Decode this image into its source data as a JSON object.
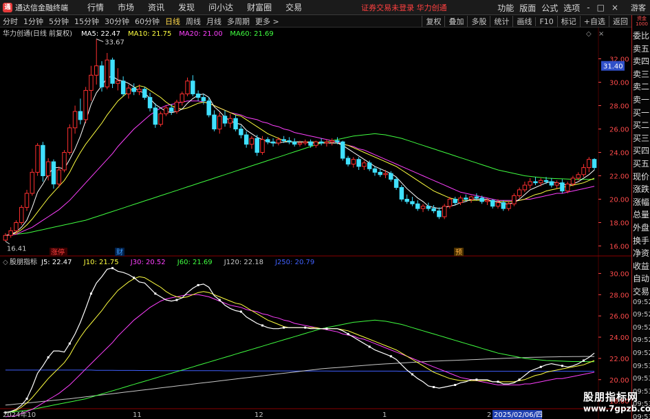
{
  "app": {
    "title": "通达信金融终端",
    "menu": [
      "行情",
      "市场",
      "资讯",
      "发现",
      "问小达",
      "财富圈",
      "交易"
    ],
    "notice": "证券交易未登录  华力创通",
    "right_menu": [
      "功能",
      "版面",
      "公式",
      "选项"
    ],
    "window_controls": [
      "-",
      "□",
      "×"
    ],
    "guest": "游客"
  },
  "toolbar": {
    "periods": [
      "分时",
      "1分钟",
      "5分钟",
      "15分钟",
      "30分钟",
      "60分钟",
      "日线",
      "周线",
      "月线",
      "多周期",
      "更多 >"
    ],
    "active_period": "日线",
    "right_tools": [
      "复权",
      "叠加",
      "多股",
      "统计",
      "画线",
      "F10",
      "标记",
      "+自选",
      "返回"
    ]
  },
  "right_column": {
    "logo": "资金 1000",
    "rows": [
      "委比",
      "卖五",
      "卖四",
      "卖三",
      "卖二",
      "卖一",
      "买一",
      "买二",
      "买三",
      "买四",
      "买五",
      "现价",
      "涨跌",
      "涨幅",
      "总量",
      "外盘",
      "换手",
      "净资",
      "收益",
      "自动",
      "交易",
      "09:52",
      "09:52",
      "09:52",
      "09:52",
      "09:52",
      "09:53",
      "09:53",
      "09:53",
      "09:53",
      "09:53"
    ]
  },
  "main_panel": {
    "stock_label": "华力创通(日线 前复权)",
    "legend": [
      {
        "label": "MA5: 22.47",
        "color": "#ffffff"
      },
      {
        "label": "MA10: 21.75",
        "color": "#ffff40"
      },
      {
        "label": "MA20: 21.00",
        "color": "#ff40ff"
      },
      {
        "label": "MA60: 21.69",
        "color": "#40ff40"
      }
    ],
    "high_annotation": "33.67",
    "low_annotation": "16.41",
    "current_price_tag": "31.40",
    "event_tags": [
      "涨停",
      "财",
      "预"
    ],
    "y_ticks": [
      "32.00",
      "30.00",
      "28.00",
      "26.00",
      "24.00",
      "22.00",
      "20.00",
      "18.00",
      "16.00"
    ]
  },
  "sub_panel": {
    "indicator_name": "股朋指标",
    "legend": [
      {
        "label": "J5: 22.47",
        "color": "#ffffff"
      },
      {
        "label": "J10: 21.75",
        "color": "#ffff40"
      },
      {
        "label": "J30: 20.52",
        "color": "#ff40ff"
      },
      {
        "label": "J60: 21.69",
        "color": "#40ff40"
      },
      {
        "label": "J120: 22.18",
        "color": "#c8c8c8"
      },
      {
        "label": "J250: 20.79",
        "color": "#4060ff"
      }
    ],
    "y_ticks": [
      "30.00",
      "28.00",
      "26.00",
      "24.00",
      "22.00",
      "20.00",
      "18.00"
    ]
  },
  "x_axis_labels": [
    "2024年10",
    "11",
    "12",
    "1",
    "2",
    "2025/02/06/四"
  ],
  "watermark": {
    "name": "股朋指标网",
    "url": "www.7gpzb.com"
  },
  "colors": {
    "up": "#ff3030",
    "down": "#40e0ff",
    "ma5": "#ffffff",
    "ma10": "#ffff40",
    "ma20": "#ff40ff",
    "ma60": "#40ff40",
    "j120": "#c8c8c8",
    "j250": "#4060ff",
    "grid": "#4a0000"
  },
  "chart_data": {
    "type": "candlestick",
    "ylim": [
      15.5,
      33.5
    ],
    "sub_ylim": [
      17.2,
      31.0
    ],
    "candles": [
      [
        16.5,
        17.1,
        16.4,
        16.9
      ],
      [
        16.9,
        17.6,
        16.7,
        17.3
      ],
      [
        17.3,
        18.2,
        17.0,
        18.0
      ],
      [
        18.0,
        19.5,
        17.8,
        19.3
      ],
      [
        19.3,
        20.8,
        19.0,
        20.5
      ],
      [
        20.5,
        22.6,
        20.3,
        22.3
      ],
      [
        22.3,
        24.8,
        22.0,
        24.6
      ],
      [
        24.6,
        24.9,
        21.5,
        22.0
      ],
      [
        22.0,
        23.5,
        21.6,
        23.2
      ],
      [
        23.2,
        23.4,
        20.9,
        21.3
      ],
      [
        21.3,
        22.8,
        21.0,
        22.5
      ],
      [
        22.5,
        24.2,
        22.3,
        24.0
      ],
      [
        24.0,
        26.4,
        23.8,
        26.1
      ],
      [
        26.1,
        28.0,
        25.6,
        27.5
      ],
      [
        27.5,
        28.6,
        26.4,
        26.8
      ],
      [
        26.8,
        29.6,
        26.5,
        29.3
      ],
      [
        29.3,
        31.4,
        28.4,
        30.6
      ],
      [
        30.6,
        33.7,
        29.8,
        31.4
      ],
      [
        31.4,
        31.8,
        29.2,
        29.6
      ],
      [
        29.6,
        32.5,
        29.4,
        31.9
      ],
      [
        31.9,
        32.1,
        29.5,
        29.9
      ],
      [
        29.9,
        31.2,
        29.3,
        30.1
      ],
      [
        30.1,
        30.5,
        28.8,
        29.0
      ],
      [
        29.0,
        29.8,
        28.6,
        29.5
      ],
      [
        29.5,
        29.9,
        28.9,
        29.2
      ],
      [
        29.2,
        29.8,
        28.9,
        29.4
      ],
      [
        29.4,
        29.6,
        28.5,
        28.7
      ],
      [
        28.7,
        29.1,
        27.5,
        27.8
      ],
      [
        27.8,
        28.2,
        26.1,
        26.4
      ],
      [
        26.4,
        27.5,
        26.2,
        27.3
      ],
      [
        27.3,
        28.0,
        27.1,
        27.8
      ],
      [
        27.8,
        28.1,
        27.2,
        27.5
      ],
      [
        27.5,
        28.5,
        27.3,
        28.3
      ],
      [
        28.3,
        29.2,
        28.0,
        29.0
      ],
      [
        29.0,
        30.4,
        28.8,
        30.1
      ],
      [
        30.1,
        30.6,
        28.8,
        29.0
      ],
      [
        29.0,
        29.3,
        28.4,
        28.7
      ],
      [
        28.7,
        29.0,
        28.1,
        28.4
      ],
      [
        28.4,
        28.7,
        27.0,
        27.2
      ],
      [
        27.2,
        27.6,
        25.8,
        26.0
      ],
      [
        26.0,
        27.4,
        25.6,
        27.1
      ],
      [
        27.1,
        27.6,
        26.2,
        26.5
      ],
      [
        26.5,
        27.3,
        26.1,
        26.9
      ],
      [
        26.9,
        27.2,
        25.8,
        26.0
      ],
      [
        26.0,
        26.3,
        25.2,
        25.5
      ],
      [
        25.5,
        25.8,
        24.4,
        24.7
      ],
      [
        24.7,
        25.4,
        24.3,
        25.2
      ],
      [
        25.2,
        25.5,
        23.7,
        24.0
      ],
      [
        24.0,
        25.4,
        23.8,
        25.1
      ],
      [
        25.1,
        25.3,
        24.7,
        24.9
      ],
      [
        24.9,
        25.2,
        24.5,
        24.8
      ],
      [
        24.8,
        25.3,
        24.6,
        25.1
      ],
      [
        25.1,
        25.4,
        24.8,
        25.0
      ],
      [
        25.0,
        25.3,
        24.7,
        24.9
      ],
      [
        24.9,
        25.2,
        24.5,
        24.7
      ],
      [
        24.7,
        25.0,
        24.5,
        24.8
      ],
      [
        24.8,
        25.1,
        24.6,
        24.9
      ],
      [
        24.9,
        25.1,
        24.4,
        24.6
      ],
      [
        24.6,
        25.0,
        24.4,
        24.9
      ],
      [
        24.9,
        25.2,
        24.6,
        24.8
      ],
      [
        24.8,
        25.1,
        24.5,
        24.9
      ],
      [
        24.9,
        25.2,
        24.6,
        25.0
      ],
      [
        25.0,
        25.3,
        24.7,
        24.9
      ],
      [
        24.9,
        25.0,
        23.3,
        23.5
      ],
      [
        23.5,
        23.7,
        22.8,
        23.0
      ],
      [
        23.0,
        23.6,
        22.7,
        23.4
      ],
      [
        23.4,
        23.6,
        22.5,
        22.8
      ],
      [
        22.8,
        23.3,
        22.5,
        23.1
      ],
      [
        23.1,
        23.3,
        22.4,
        22.6
      ],
      [
        22.6,
        22.8,
        22.0,
        22.3
      ],
      [
        22.3,
        22.6,
        21.9,
        22.1
      ],
      [
        22.1,
        22.5,
        21.8,
        22.2
      ],
      [
        22.2,
        22.4,
        21.5,
        21.7
      ],
      [
        21.7,
        21.9,
        20.8,
        21.0
      ],
      [
        21.0,
        21.2,
        19.8,
        20.0
      ],
      [
        20.0,
        20.4,
        19.6,
        19.8
      ],
      [
        19.8,
        20.2,
        19.4,
        19.6
      ],
      [
        19.6,
        19.9,
        19.0,
        19.2
      ],
      [
        19.2,
        19.6,
        18.9,
        19.4
      ],
      [
        19.4,
        19.7,
        19.0,
        19.2
      ],
      [
        19.2,
        19.5,
        18.8,
        19.0
      ],
      [
        19.0,
        19.3,
        18.3,
        18.5
      ],
      [
        18.5,
        19.6,
        18.3,
        19.4
      ],
      [
        19.4,
        20.2,
        19.2,
        20.0
      ],
      [
        20.0,
        20.2,
        19.5,
        19.7
      ],
      [
        19.7,
        20.3,
        19.5,
        20.1
      ],
      [
        20.1,
        20.4,
        19.8,
        20.0
      ],
      [
        20.0,
        20.3,
        19.7,
        20.2
      ],
      [
        20.2,
        20.5,
        19.9,
        20.1
      ],
      [
        20.1,
        20.3,
        19.6,
        19.8
      ],
      [
        19.8,
        20.1,
        19.5,
        19.9
      ],
      [
        19.9,
        20.0,
        19.2,
        19.4
      ],
      [
        19.4,
        20.0,
        19.2,
        19.7
      ],
      [
        19.7,
        19.9,
        19.0,
        19.2
      ],
      [
        19.2,
        19.8,
        19.0,
        19.6
      ],
      [
        19.6,
        20.5,
        19.4,
        20.3
      ],
      [
        20.3,
        21.0,
        20.1,
        20.8
      ],
      [
        20.8,
        21.5,
        20.6,
        21.2
      ],
      [
        21.2,
        21.8,
        20.9,
        21.5
      ],
      [
        21.5,
        21.9,
        21.2,
        21.4
      ],
      [
        21.4,
        21.8,
        21.1,
        21.6
      ],
      [
        21.6,
        21.9,
        21.3,
        21.5
      ],
      [
        21.5,
        21.8,
        21.0,
        21.2
      ],
      [
        21.2,
        21.6,
        20.9,
        21.4
      ],
      [
        21.4,
        21.7,
        20.5,
        20.7
      ],
      [
        20.7,
        21.5,
        20.5,
        21.3
      ],
      [
        21.3,
        22.0,
        21.1,
        21.8
      ],
      [
        21.8,
        22.3,
        21.6,
        22.1
      ],
      [
        22.1,
        23.0,
        21.9,
        22.7
      ],
      [
        22.7,
        23.6,
        22.3,
        23.4
      ],
      [
        23.4,
        23.5,
        22.5,
        22.7
      ]
    ],
    "ma5": [
      16.9,
      17.0,
      17.2,
      17.6,
      18.2,
      19.3,
      20.6,
      21.3,
      22.1,
      22.7,
      22.7,
      22.6,
      23.4,
      24.3,
      25.4,
      26.7,
      28.1,
      29.1,
      29.7,
      30.4,
      30.5,
      30.2,
      30.1,
      29.9,
      29.6,
      29.2,
      29.1,
      28.6,
      28.1,
      27.8,
      27.5,
      27.4,
      27.5,
      27.7,
      28.2,
      28.6,
      28.9,
      29.0,
      28.7,
      27.9,
      27.5,
      27.0,
      26.7,
      26.5,
      26.4,
      25.9,
      25.6,
      25.3,
      25.1,
      24.9,
      24.8,
      24.8,
      24.9,
      24.9,
      24.9,
      24.9,
      24.9,
      24.8,
      24.8,
      24.8,
      24.8,
      24.8,
      24.8,
      24.6,
      24.3,
      24.0,
      23.7,
      23.4,
      23.1,
      22.8,
      22.6,
      22.4,
      22.2,
      21.9,
      21.4,
      20.9,
      20.5,
      20.1,
      19.8,
      19.4,
      19.3,
      19.2,
      19.3,
      19.4,
      19.5,
      19.7,
      19.8,
      20.0,
      20.0,
      20.0,
      20.0,
      19.8,
      19.8,
      19.6,
      19.6,
      19.7,
      20.0,
      20.4,
      20.8,
      21.0,
      21.2,
      21.4,
      21.5,
      21.4,
      21.3,
      21.2,
      21.3,
      21.5,
      21.8,
      22.1,
      22.5
    ],
    "ma10": [
      16.9,
      17.0,
      17.1,
      17.4,
      17.8,
      18.3,
      18.9,
      19.5,
      20.1,
      20.6,
      21.1,
      21.6,
      22.3,
      23.2,
      24.0,
      24.7,
      25.3,
      25.9,
      26.5,
      27.2,
      27.8,
      28.4,
      28.8,
      29.2,
      29.5,
      29.7,
      29.6,
      29.3,
      29.0,
      28.7,
      28.3,
      28.0,
      27.8,
      27.7,
      27.8,
      28.0,
      28.2,
      28.3,
      28.2,
      28.0,
      27.8,
      27.6,
      27.4,
      27.2,
      27.1,
      26.8,
      26.5,
      26.2,
      25.9,
      25.6,
      25.4,
      25.2,
      25.0,
      24.9,
      24.9,
      24.9,
      24.9,
      24.9,
      24.9,
      24.8,
      24.8,
      24.8,
      24.8,
      24.7,
      24.6,
      24.4,
      24.2,
      24.0,
      23.8,
      23.6,
      23.4,
      23.2,
      23.0,
      22.8,
      22.5,
      22.2,
      21.9,
      21.6,
      21.3,
      21.0,
      20.7,
      20.5,
      20.3,
      20.1,
      20.0,
      19.9,
      19.9,
      19.9,
      19.9,
      19.9,
      19.9,
      19.8,
      19.8,
      19.8,
      19.8,
      19.8,
      19.9,
      20.0,
      20.2,
      20.4,
      20.5,
      20.7,
      20.8,
      20.9,
      21.0,
      21.1,
      21.2,
      21.3,
      21.4,
      21.6,
      21.8
    ],
    "ma20": [
      16.9,
      16.95,
      17.0,
      17.2,
      17.4,
      17.6,
      17.9,
      18.2,
      18.5,
      18.8,
      19.1,
      19.5,
      19.9,
      20.4,
      20.9,
      21.4,
      21.9,
      22.4,
      22.9,
      23.4,
      23.9,
      24.5,
      25.0,
      25.5,
      26.0,
      26.4,
      26.8,
      27.2,
      27.5,
      27.8,
      28.0,
      28.1,
      28.2,
      28.3,
      28.4,
      28.4,
      28.4,
      28.3,
      28.2,
      28.0,
      27.8,
      27.6,
      27.4,
      27.3,
      27.2,
      27.0,
      26.9,
      26.8,
      26.6,
      26.5,
      26.3,
      26.2,
      26.0,
      25.9,
      25.7,
      25.6,
      25.5,
      25.4,
      25.3,
      25.2,
      25.1,
      25.0,
      24.9,
      24.7,
      24.6,
      24.5,
      24.3,
      24.2,
      24.0,
      23.8,
      23.6,
      23.4,
      23.2,
      23.0,
      22.8,
      22.6,
      22.4,
      22.2,
      22.0,
      21.8,
      21.6,
      21.4,
      21.2,
      21.0,
      20.8,
      20.6,
      20.5,
      20.4,
      20.3,
      20.2,
      20.1,
      20.0,
      19.9,
      19.9,
      19.9,
      19.9,
      19.9,
      20.0,
      20.0,
      20.1,
      20.2,
      20.3,
      20.4,
      20.5,
      20.5,
      20.6,
      20.7,
      20.8,
      20.9,
      21.0,
      21.1
    ],
    "ma60": [
      16.9,
      16.95,
      17.0,
      17.05,
      17.1,
      17.2,
      17.3,
      17.4,
      17.5,
      17.6,
      17.7,
      17.8,
      17.9,
      18.0,
      18.1,
      18.2,
      18.35,
      18.5,
      18.65,
      18.8,
      18.95,
      19.1,
      19.25,
      19.4,
      19.55,
      19.7,
      19.85,
      20.0,
      20.15,
      20.3,
      20.45,
      20.6,
      20.75,
      20.9,
      21.05,
      21.2,
      21.35,
      21.5,
      21.65,
      21.8,
      21.95,
      22.1,
      22.25,
      22.4,
      22.55,
      22.7,
      22.85,
      23.0,
      23.15,
      23.3,
      23.45,
      23.6,
      23.75,
      23.9,
      24.05,
      24.2,
      24.35,
      24.5,
      24.65,
      24.8,
      24.9,
      25.0,
      25.1,
      25.2,
      25.3,
      25.4,
      25.45,
      25.5,
      25.55,
      25.6,
      25.55,
      25.5,
      25.4,
      25.3,
      25.2,
      25.05,
      24.9,
      24.75,
      24.6,
      24.45,
      24.3,
      24.15,
      24.0,
      23.85,
      23.7,
      23.55,
      23.4,
      23.25,
      23.1,
      22.95,
      22.8,
      22.65,
      22.5,
      22.4,
      22.3,
      22.2,
      22.1,
      22.0,
      21.95,
      21.9,
      21.85,
      21.8,
      21.78,
      21.76,
      21.74,
      21.72,
      21.7,
      21.7,
      21.7,
      21.69,
      21.69
    ],
    "j250": [
      20.9,
      20.9,
      20.9,
      20.9,
      20.9,
      20.9,
      20.9,
      20.9,
      20.9,
      20.9,
      20.9,
      20.9,
      20.9,
      20.9,
      20.9,
      20.9,
      20.9,
      20.88,
      20.88,
      20.88,
      20.88,
      20.87,
      20.87,
      20.87,
      20.87,
      20.86,
      20.86,
      20.86,
      20.86,
      20.85,
      20.85,
      20.85,
      20.85,
      20.85,
      20.85,
      20.84,
      20.84,
      20.84,
      20.84,
      20.84,
      20.84,
      20.83,
      20.83,
      20.83,
      20.83,
      20.83,
      20.83,
      20.82,
      20.82,
      20.82,
      20.82,
      20.82,
      20.82,
      20.82,
      20.81,
      20.81,
      20.81,
      20.81,
      20.81,
      20.81,
      20.81,
      20.8,
      20.8,
      20.8,
      20.8,
      20.8,
      20.8,
      20.8,
      20.8,
      20.8,
      20.8,
      20.8,
      20.8,
      20.8,
      20.79,
      20.79,
      20.79,
      20.79,
      20.79,
      20.79,
      20.79,
      20.79,
      20.79,
      20.79,
      20.79,
      20.79,
      20.79,
      20.79,
      20.79,
      20.79,
      20.79,
      20.79,
      20.79,
      20.79,
      20.79,
      20.79,
      20.79,
      20.79,
      20.79,
      20.79,
      20.79,
      20.79,
      20.79,
      20.79,
      20.79,
      20.79,
      20.79,
      20.79,
      20.79,
      20.79,
      20.79
    ],
    "j120": [
      17.6,
      17.65,
      17.7,
      17.75,
      17.8,
      17.85,
      17.9,
      17.95,
      18.0,
      18.05,
      18.1,
      18.15,
      18.2,
      18.26,
      18.32,
      18.38,
      18.44,
      18.5,
      18.56,
      18.62,
      18.68,
      18.74,
      18.8,
      18.86,
      18.92,
      18.98,
      19.04,
      19.1,
      19.16,
      19.22,
      19.28,
      19.34,
      19.4,
      19.46,
      19.52,
      19.58,
      19.64,
      19.7,
      19.76,
      19.82,
      19.88,
      19.94,
      20.0,
      20.06,
      20.12,
      20.18,
      20.24,
      20.3,
      20.36,
      20.42,
      20.48,
      20.54,
      20.6,
      20.66,
      20.72,
      20.78,
      20.84,
      20.9,
      20.96,
      21.02,
      21.06,
      21.1,
      21.14,
      21.18,
      21.22,
      21.26,
      21.3,
      21.34,
      21.38,
      21.42,
      21.45,
      21.48,
      21.51,
      21.54,
      21.57,
      21.6,
      21.63,
      21.66,
      21.69,
      21.72,
      21.74,
      21.76,
      21.78,
      21.8,
      21.82,
      21.84,
      21.86,
      21.88,
      21.9,
      21.92,
      21.94,
      21.96,
      21.98,
      22.0,
      22.02,
      22.04,
      22.06,
      22.08,
      22.1,
      22.11,
      22.12,
      22.13,
      22.14,
      22.15,
      22.16,
      22.16,
      22.17,
      22.17,
      22.18,
      22.18,
      22.18
    ]
  }
}
